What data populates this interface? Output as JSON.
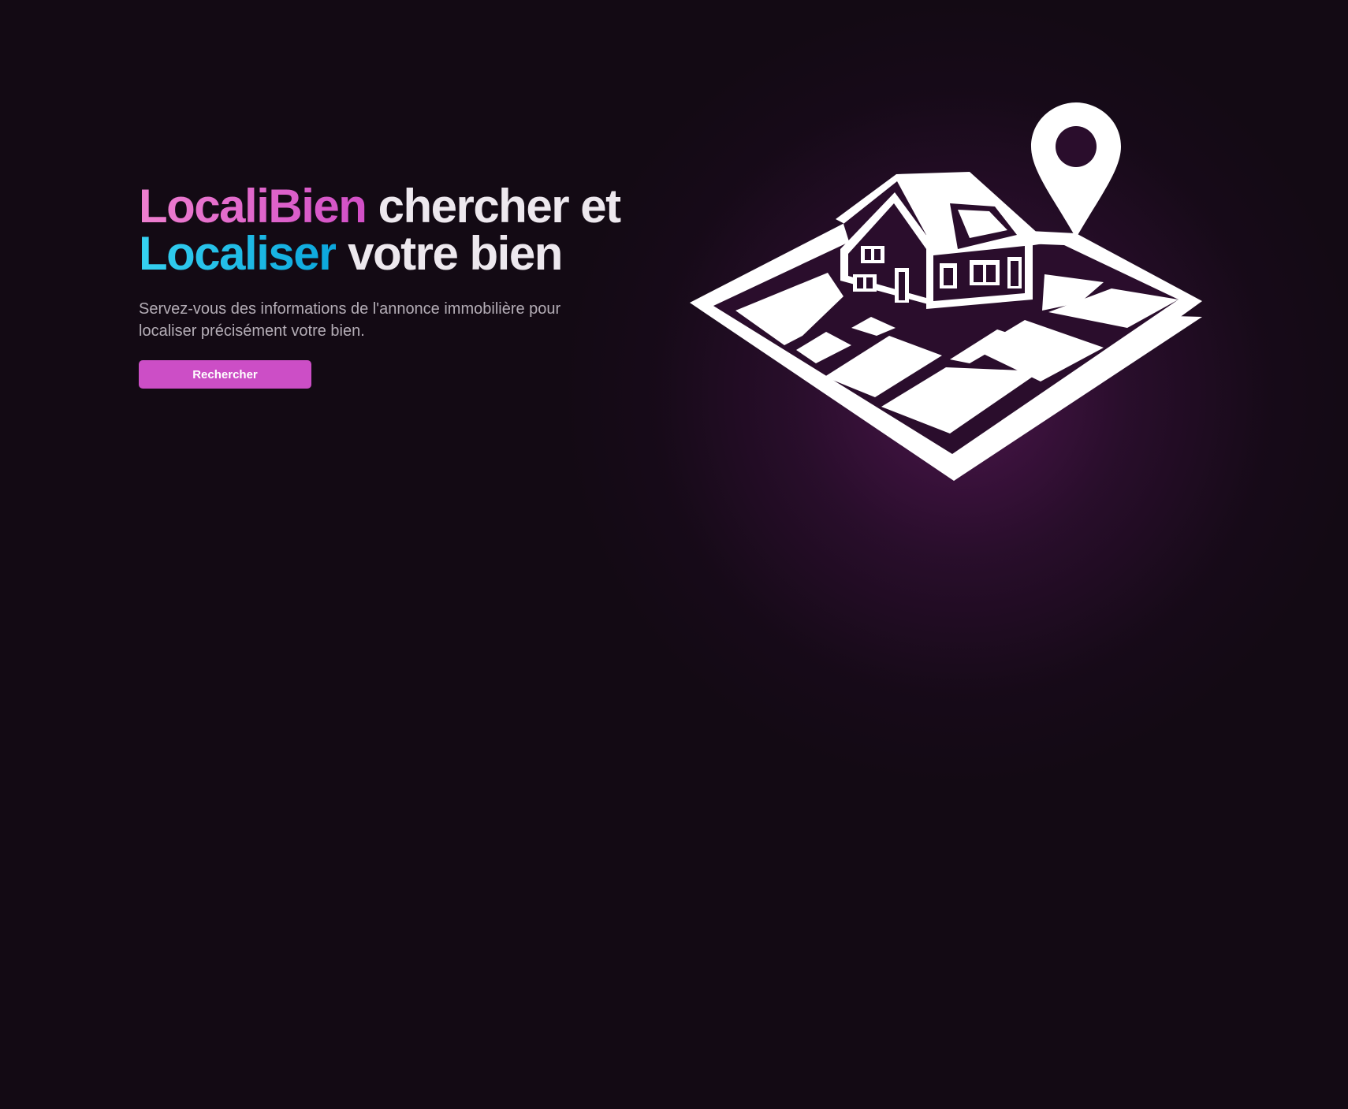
{
  "hero": {
    "brand": "LocaliBien",
    "title_line1_rest": " chercher et",
    "title_highlight2": "Localiser",
    "title_line2_rest": " votre bien",
    "description": "Servez-vous des informations de l'annonce immobilière pour localiser précisément votre bien.",
    "cta_label": "Rechercher"
  },
  "illustration": {
    "icons": [
      "house-icon",
      "map-pin-icon",
      "map-grid-icon"
    ]
  },
  "colors": {
    "background": "#130a14",
    "brand_pink": "#cc4ec6",
    "accent_blue": "#1ab8e6",
    "glow": "#6e1e6e",
    "illustration": "#ffffff",
    "illustration_shadow": "#3c1440"
  }
}
